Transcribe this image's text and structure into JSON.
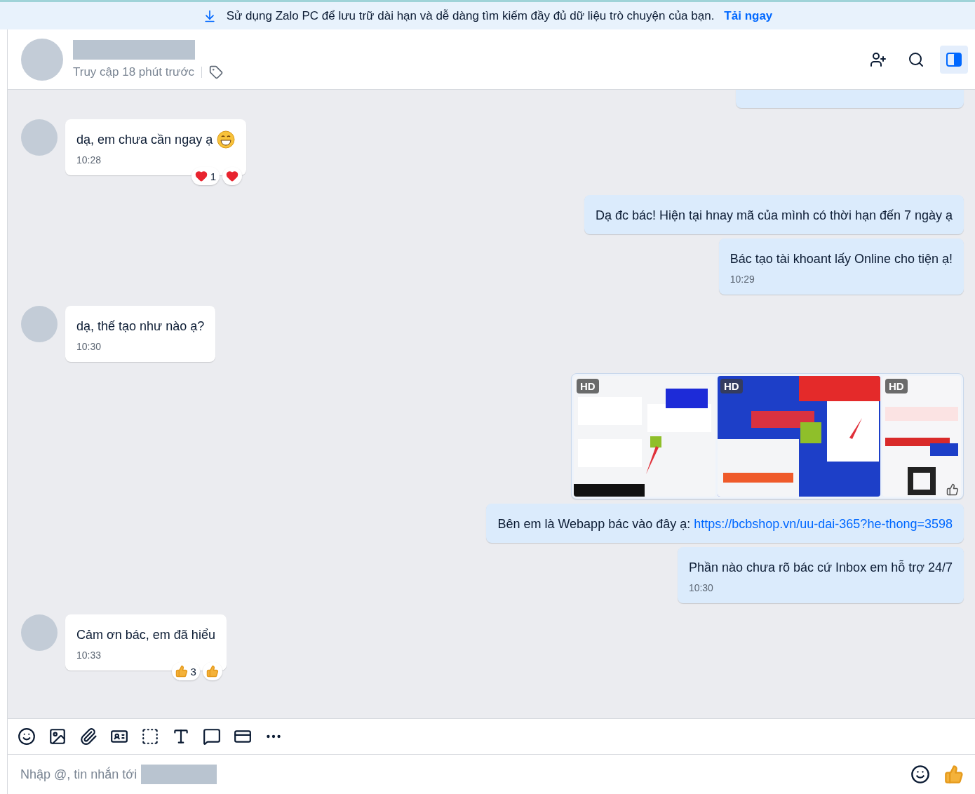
{
  "banner": {
    "text": "Sử dụng Zalo PC để lưu trữ dài hạn và dễ dàng tìm kiếm đầy đủ dữ liệu trò chuyện của bạn.",
    "link": "Tải ngay"
  },
  "header": {
    "status": "Truy cập 18 phút trước",
    "panel_toggle": {
      "selected": true
    }
  },
  "messages": [
    {
      "outgoing": true,
      "kind": "cut_off"
    },
    {
      "outgoing": false,
      "kind": "text",
      "text": "dạ, em chưa cần ngay ạ",
      "emoji": true,
      "time": "10:28",
      "reactions": [
        {
          "kind": "heart",
          "count": "1"
        },
        {
          "kind": "heart"
        }
      ]
    },
    {
      "outgoing": true,
      "kind": "text",
      "text": "Dạ đc bác! Hiện tại hnay mã của mình có thời hạn đến 7 ngày ạ"
    },
    {
      "outgoing": true,
      "kind": "text",
      "text": "Bác tạo tài khoant lấy Online cho tiện ạ!",
      "time": "10:29"
    },
    {
      "outgoing": false,
      "kind": "text",
      "text": "dạ, thế tạo như nào ạ?",
      "time": "10:30"
    },
    {
      "outgoing": true,
      "kind": "images",
      "images": [
        {
          "badge": "HD"
        },
        {
          "badge": "HD"
        },
        {
          "badge": "HD"
        }
      ]
    },
    {
      "outgoing": true,
      "kind": "text",
      "text": "Bên em là Webapp bác vào đây ạ: ",
      "link": "https://bcbshop.vn/uu-dai-365?he-thong=3598"
    },
    {
      "outgoing": true,
      "kind": "text",
      "text": "Phần nào chưa rõ bác cứ Inbox em hỗ trợ 24/7",
      "time": "10:30"
    },
    {
      "outgoing": false,
      "kind": "text",
      "text": "Cảm ơn bác, em đã hiểu",
      "time": "10:33",
      "reactions": [
        {
          "kind": "like",
          "count": "3"
        },
        {
          "kind": "like"
        }
      ]
    }
  ],
  "composer": {
    "placeholder": "Nhập @, tin nhắn tới"
  }
}
